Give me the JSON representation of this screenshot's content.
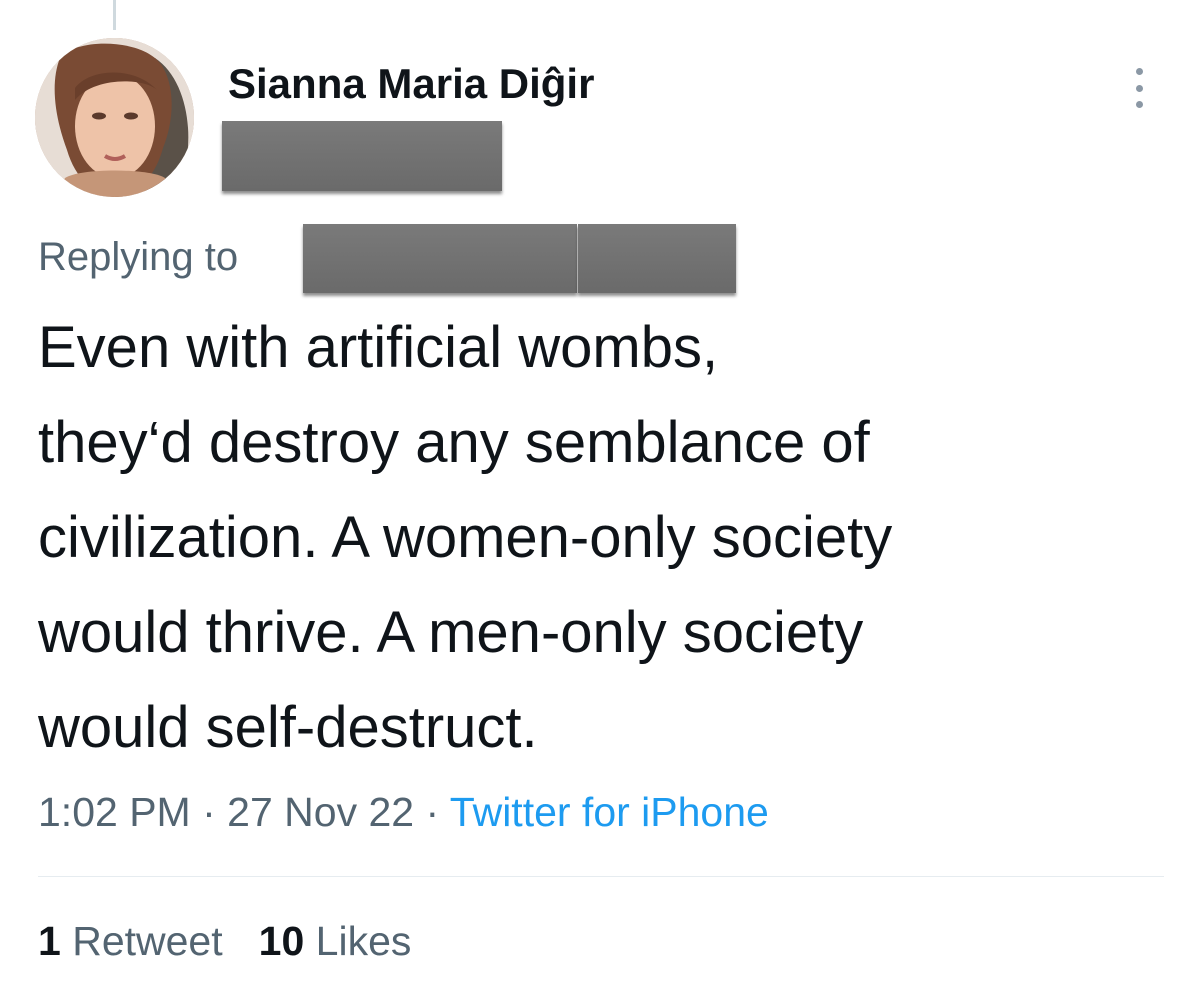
{
  "tweet": {
    "author": {
      "name": "Sianna Maria Diĝir",
      "avatar_icon": "profile-photo"
    },
    "reply_prefix": "Replying to",
    "text_lines": [
      "Even with artificial wombs,",
      "they‘d destroy any semblance of",
      "civilization. A women-only society",
      "would thrive. A men-only society",
      "would self-destruct."
    ],
    "time": "1:02 PM",
    "date": "27 Nov 22",
    "separator": "·",
    "source": "Twitter for iPhone",
    "stats": {
      "retweets_count": "1",
      "retweets_label": "Retweet",
      "likes_count": "10",
      "likes_label": "Likes"
    },
    "more_icon": "more-vertical-icon"
  },
  "colors": {
    "text_primary": "#0f1419",
    "text_secondary": "#536471",
    "link": "#1d9bf0",
    "divider": "#e6ecf0",
    "redaction": "#707070"
  }
}
